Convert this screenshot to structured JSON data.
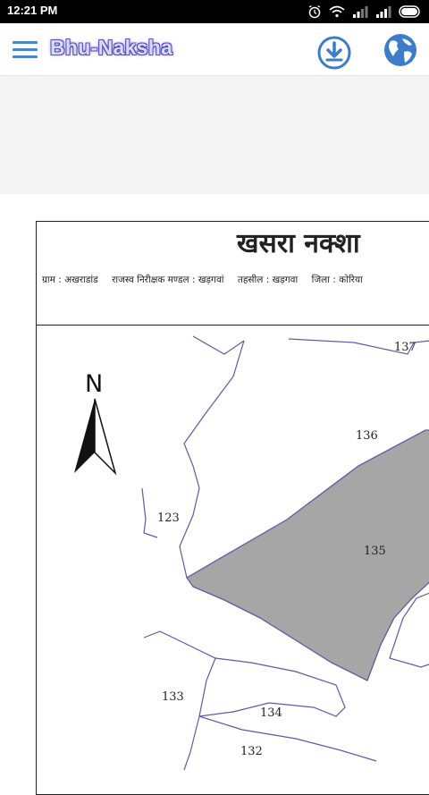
{
  "status_bar": {
    "time": "12:21 PM"
  },
  "app_bar": {
    "title": "Bhu-Naksha"
  },
  "map": {
    "title": "खसरा नक्शा",
    "info": {
      "village": "ग्राम : अखराडांड",
      "revenue_circle": "राजस्व निरीक्षक मण्डल : खड़गवां",
      "tehsil": "तहसील : खड़गवा",
      "district": "जिला : कोरिया"
    },
    "north_label": "N",
    "plot_labels": {
      "p137": "137",
      "p136": "136",
      "p135": "135",
      "p123": "123",
      "p133": "133",
      "p134": "134",
      "p132": "132"
    },
    "highlight_color": "#a6a6a6",
    "boundary_color": "#5f5aa6"
  }
}
